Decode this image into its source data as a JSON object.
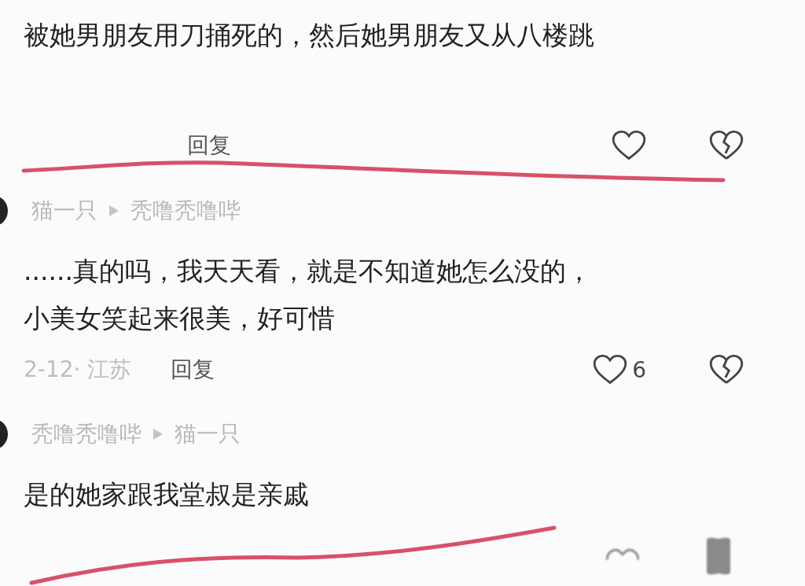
{
  "comments": [
    {
      "kind": "top",
      "lines": [
        "被她男朋友用刀捅死的，然后她男朋友又从八楼跳"
      ],
      "reply": "回复",
      "blurred": false
    },
    {
      "kind": "reply",
      "author": "猫一只",
      "target": "秃噜秃噜哔",
      "lines": [
        "......真的吗，我天天看，就是不知道她怎么没的，",
        "小美女笑起来很美，好可惜"
      ],
      "meta": "2-12· 江苏",
      "reply": "回复",
      "likes": "6",
      "blurred": false
    },
    {
      "kind": "reply",
      "author": "秃噜秃噜哔",
      "target": "猫一只",
      "lines": [
        "是的她家跟我堂叔是亲戚"
      ],
      "blurred": true
    }
  ]
}
